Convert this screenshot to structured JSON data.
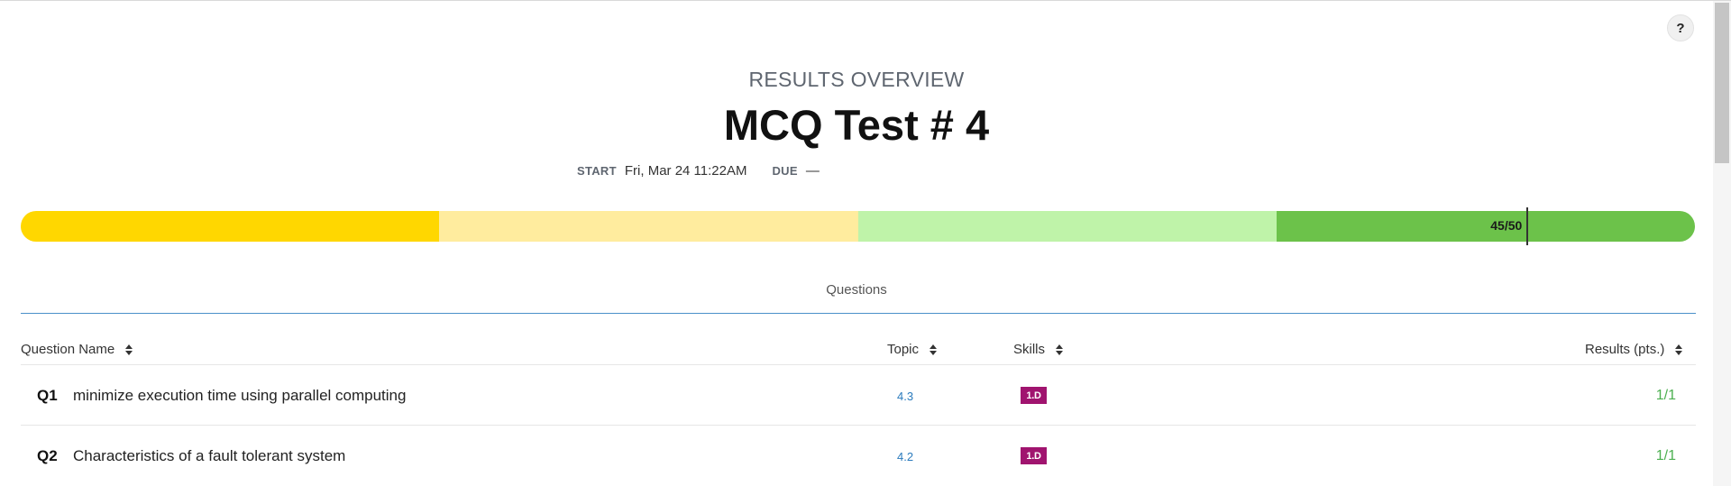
{
  "header": {
    "overline": "RESULTS OVERVIEW",
    "title": "MCQ Test # 4",
    "start_label": "START",
    "start_value": "Fri, Mar 24 11:22AM",
    "due_label": "DUE",
    "due_value": "—"
  },
  "help": {
    "label": "?"
  },
  "score": {
    "label": "45/50",
    "value": 45,
    "max": 50,
    "band_colors": [
      "#FFD700",
      "#FFEC9E",
      "#BFF3A9",
      "#6CC24A"
    ]
  },
  "tabs": {
    "questions_label": "Questions"
  },
  "table": {
    "columns": [
      "Question Name",
      "Topic",
      "Skills",
      "Results (pts.)"
    ],
    "rows": [
      {
        "num": "Q1",
        "name": "minimize execution time using parallel computing",
        "topic": "4.3",
        "skill": "1.D",
        "result": "1/1"
      },
      {
        "num": "Q2",
        "name": "Characteristics of a fault tolerant system",
        "topic": "4.2",
        "skill": "1.D",
        "result": "1/1"
      }
    ]
  },
  "colors": {
    "skill_badge": "#A0146F",
    "topic_link": "#2B7BBD",
    "result_text": "#4CAF50",
    "tab_rule": "#4A90C9"
  }
}
